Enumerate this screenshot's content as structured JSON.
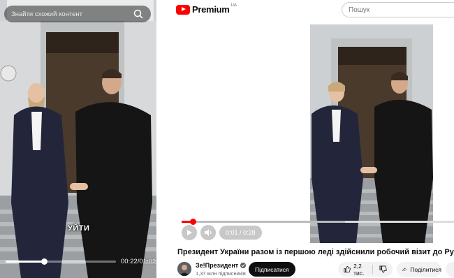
{
  "left_panel": {
    "search_text": "Знайти схожий контент",
    "caption": "УЙТИ",
    "time": "00:22/01:02",
    "progress": 0.35
  },
  "right_panel": {
    "logo_word": "Premium",
    "logo_region": "UA",
    "search_placeholder": "Пошук",
    "player": {
      "time": "0:01 / 0:28",
      "played": 0.04,
      "loaded": 0.6
    },
    "video_title": "Президент України разом із першою леді здійснили робочий візит до Румунії",
    "channel_name": "Зе!Президент",
    "subscribers": "1,37 млн підписників",
    "subscribe_label": "Підписатися",
    "likes": "2,2 тис.",
    "share_label": "Поділитися"
  },
  "colors": {
    "brand_red": "#ff0000",
    "subscribe_bg": "#0f0f0f",
    "pill_bg": "#f2f2f2"
  },
  "icons": [
    "search-icon",
    "youtube-logo-icon",
    "play-icon",
    "volume-icon",
    "verified-icon",
    "like-icon",
    "dislike-icon",
    "share-icon"
  ]
}
